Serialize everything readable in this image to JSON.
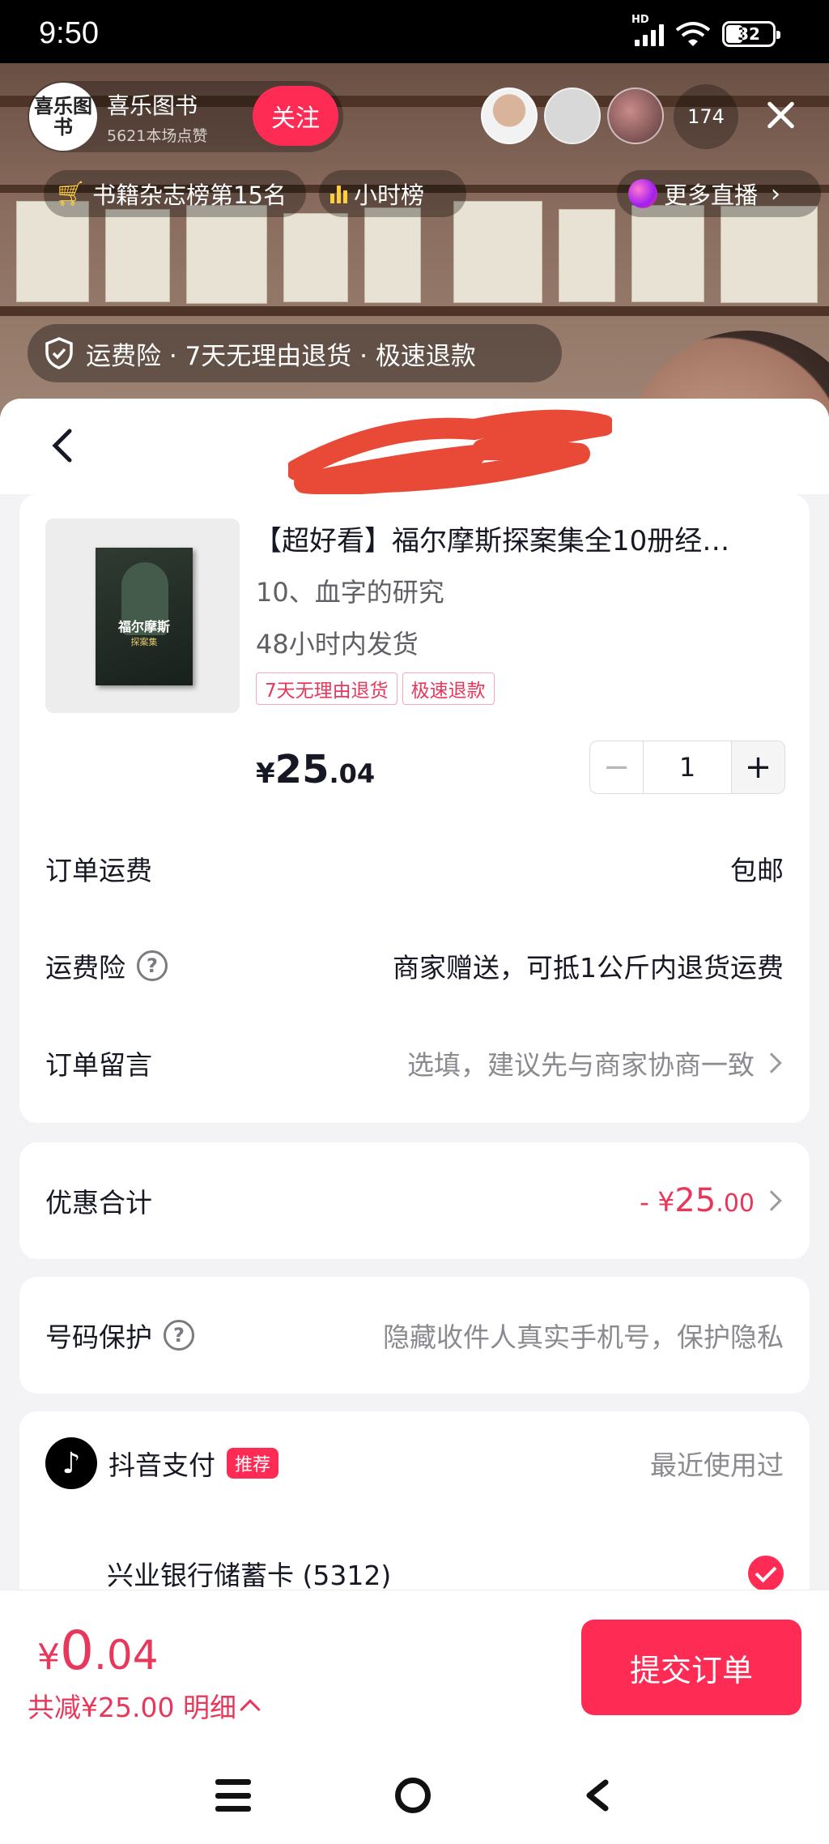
{
  "status_bar": {
    "time": "9:50",
    "network": "HD",
    "battery": "32"
  },
  "live": {
    "streamer_logo_text": "喜乐图书",
    "streamer_name": "喜乐图书",
    "streamer_sub": "5621本场点赞",
    "follow_label": "关注",
    "viewer_count": "174",
    "rank_label": "书籍杂志榜第15名",
    "hour_label": "小时榜",
    "more_live_label": "更多直播",
    "guarantee": "运费险 · 7天无理由退货 · 极速退款"
  },
  "product": {
    "cover_title": "福尔摩斯",
    "cover_sub": "探案集",
    "title": "【超好看】福尔摩斯探案集全10册经…",
    "variant": "10、血字的研究",
    "shipping": "48小时内发货",
    "tags": [
      "7天无理由退货",
      "极速退款"
    ],
    "price_currency": "¥",
    "price_int": "25",
    "price_dec": ".04",
    "quantity": "1",
    "minus": "−",
    "plus": "+"
  },
  "order_rows": {
    "freight_label": "订单运费",
    "freight_value": "包邮",
    "insurance_label": "运费险",
    "insurance_value": "商家赠送，可抵1公斤内退货运费",
    "note_label": "订单留言",
    "note_placeholder": "选填，建议先与商家协商一致"
  },
  "discount": {
    "label": "优惠合计",
    "prefix": "- ¥",
    "int": "25",
    "dec": ".00"
  },
  "privacy": {
    "label": "号码保护",
    "value": "隐藏收件人真实手机号，保护隐私"
  },
  "payment": {
    "method": "抖音支付",
    "badge": "推荐",
    "recent": "最近使用过",
    "card": "兴业银行储蓄卡 (5312)"
  },
  "footer": {
    "total_currency": "¥",
    "total_int": "0",
    "total_dec": ".04",
    "saved": "共减¥25.00 明细",
    "submit": "提交订单"
  },
  "colors": {
    "accent": "#fe2c55",
    "price_red": "#e8375a"
  }
}
